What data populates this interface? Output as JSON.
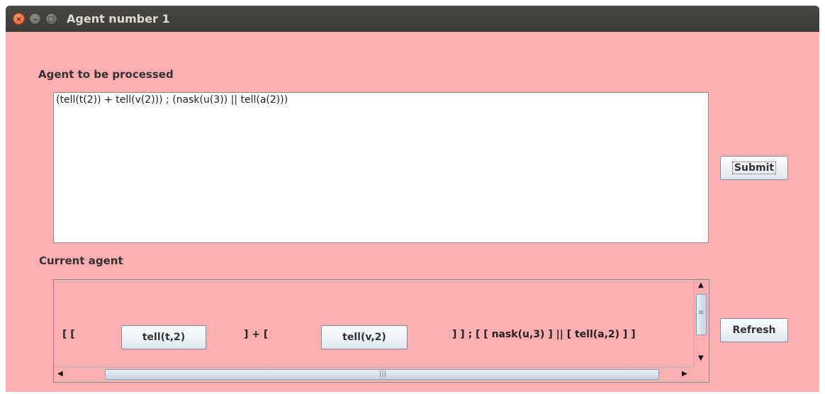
{
  "window": {
    "title": "Agent number 1"
  },
  "input_section": {
    "label": "Agent to be processed",
    "value": "(tell(t(2)) + tell(v(2))) ; (nask(u(3)) || tell(a(2)))"
  },
  "submit_label": "Submit",
  "current_section": {
    "label": "Current agent",
    "prefix": "[ [",
    "button1": "tell(t,2)",
    "middle": "] + [",
    "button2": "tell(v,2)",
    "suffix": "] ] ; [ [ nask(u,3) ] || [ tell(a,2) ] ]"
  },
  "refresh_label": "Refresh",
  "icons": [
    "close-icon",
    "minimize-icon",
    "maximize-icon",
    "scroll-up-icon",
    "scroll-down-icon",
    "scroll-left-icon",
    "scroll-right-icon"
  ]
}
